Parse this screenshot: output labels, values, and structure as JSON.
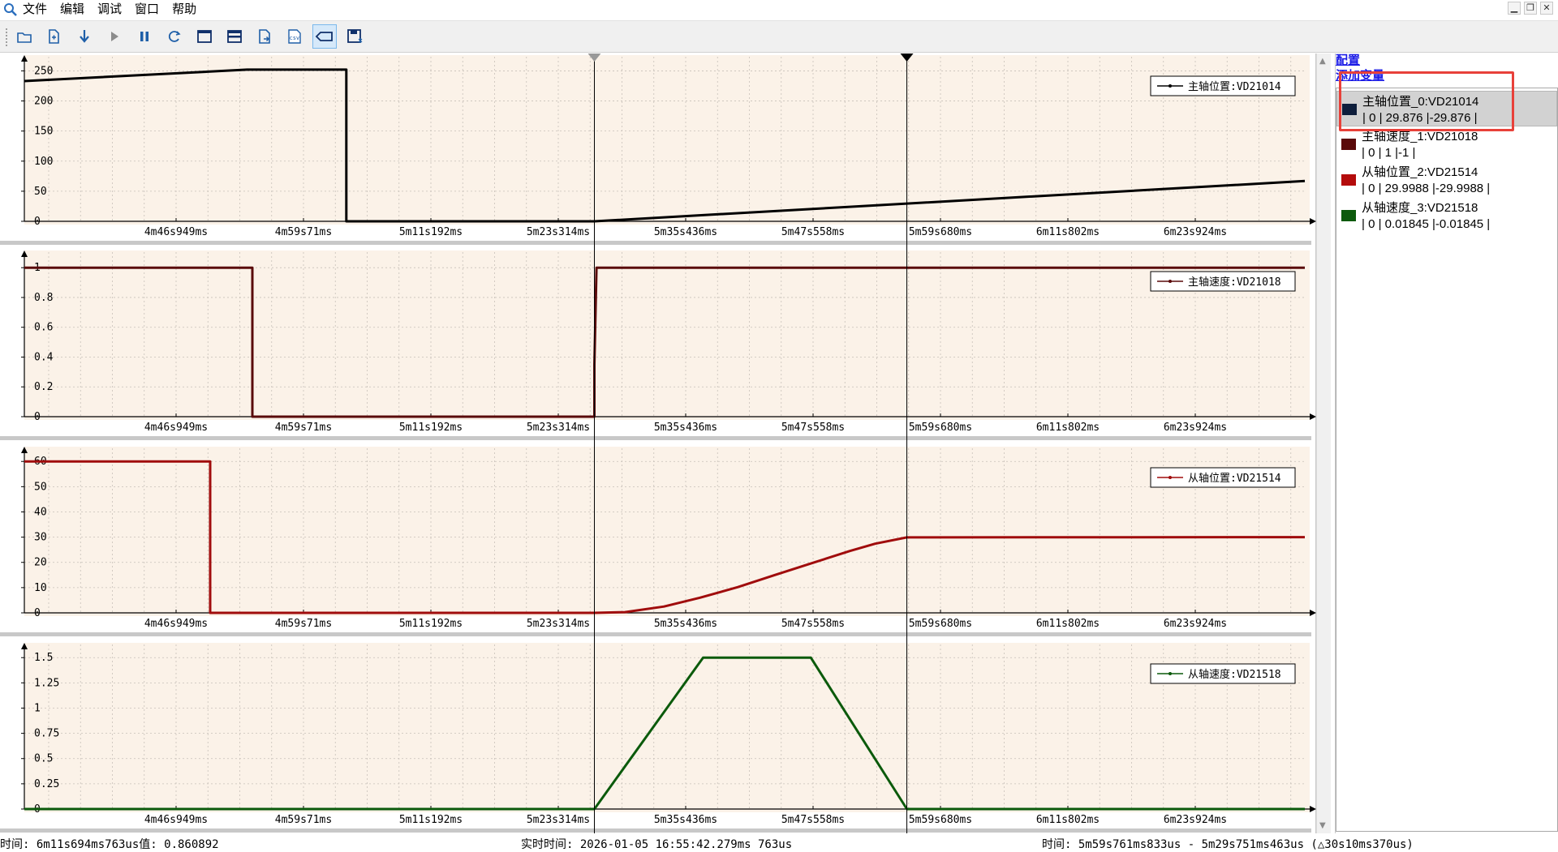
{
  "menu": {
    "items": [
      "文件",
      "编辑",
      "调试",
      "窗口",
      "帮助"
    ]
  },
  "window_controls": {
    "minimize": "▁",
    "restore": "❐",
    "close": "✕"
  },
  "toolbar": {
    "buttons": [
      {
        "name": "open-file",
        "icon": "folder-open-icon"
      },
      {
        "name": "new-file",
        "icon": "new-page-icon"
      },
      {
        "name": "download",
        "icon": "arrow-down-icon"
      },
      {
        "name": "play",
        "icon": "play-icon"
      },
      {
        "name": "pause",
        "icon": "pause-icon"
      },
      {
        "name": "refresh",
        "icon": "refresh-icon"
      },
      {
        "name": "single-view",
        "icon": "window-icon"
      },
      {
        "name": "split-view",
        "icon": "split-window-icon"
      },
      {
        "name": "export",
        "icon": "export-icon"
      },
      {
        "name": "csv",
        "icon": "csv-icon",
        "label": "csv"
      },
      {
        "name": "tag",
        "icon": "tag-icon",
        "active": true
      },
      {
        "name": "save-config",
        "icon": "save-icon"
      }
    ]
  },
  "side_panel": {
    "config_link": "配置",
    "add_variable_link": "添加变量",
    "variables": [
      {
        "name": "主轴位置_0:VD21014",
        "values": "| 0 | 29.876 |-29.876 |",
        "color": "#0e1e3c",
        "selected": true
      },
      {
        "name": "主轴速度_1:VD21018",
        "values": "| 0 | 1 |-1 |",
        "color": "#5a0a0a",
        "selected": false
      },
      {
        "name": "从轴位置_2:VD21514",
        "values": "| 0 | 29.9988 |-29.9988 |",
        "color": "#b40c0c",
        "selected": false
      },
      {
        "name": "从轴速度_3:VD21518",
        "values": "| 0 | 0.01845 |-0.01845 |",
        "color": "#0c5a0c",
        "selected": false
      }
    ]
  },
  "status_bar": {
    "time_value": "时间: 6m11s694ms763us值: 0.860892",
    "realtime": "实时时间: 2026-01-05 16:55:42.279ms 763us",
    "range": "时间: 5m59s761ms833us - 5m29s751ms463us (△30s10ms370us)"
  },
  "chart_data": [
    {
      "type": "line",
      "legend": "主轴位置:VD21014",
      "color": "#000000",
      "x_tick_labels": [
        "4m46s949ms",
        "4m59s71ms",
        "5m11s192ms",
        "5m23s314ms",
        "5m35s436ms",
        "5m47s558ms",
        "5m59s680ms",
        "6m11s802ms",
        "6m23s924ms"
      ],
      "x_range_s": [
        276.4,
        397.7
      ],
      "ylim": [
        0,
        260
      ],
      "y_ticks": [
        0,
        50,
        100,
        150,
        200,
        250
      ],
      "y_tick_labels": [
        "0",
        "50",
        "100",
        "150",
        "200",
        "250"
      ],
      "x_s": [
        276.4,
        297.5,
        306.9,
        306.9,
        330.4,
        397.7
      ],
      "y": [
        233,
        252,
        252,
        0,
        0,
        67
      ],
      "grid": true,
      "legend_position": "top-right"
    },
    {
      "type": "line",
      "legend": "主轴速度:VD21018",
      "color": "#5a0a0a",
      "x_tick_labels": [
        "4m46s949ms",
        "4m59s71ms",
        "5m11s192ms",
        "5m23s314ms",
        "5m35s436ms",
        "5m47s558ms",
        "5m59s680ms",
        "6m11s802ms",
        "6m23s924ms"
      ],
      "x_range_s": [
        276.4,
        397.7
      ],
      "ylim": [
        0,
        1.05
      ],
      "y_ticks": [
        0,
        0.2,
        0.4,
        0.6,
        0.8,
        1
      ],
      "y_tick_labels": [
        "0",
        "0.2",
        "0.4",
        "0.6",
        "0.8",
        "1"
      ],
      "x_s": [
        276.4,
        298.0,
        298.0,
        330.4,
        330.4,
        330.6,
        397.7
      ],
      "y": [
        1,
        1,
        0,
        0,
        0.35,
        1,
        1
      ],
      "grid": true,
      "legend_position": "top-right"
    },
    {
      "type": "line",
      "legend": "从轴位置:VD21514",
      "color": "#a00c0c",
      "x_tick_labels": [
        "4m46s949ms",
        "4m59s71ms",
        "5m11s192ms",
        "5m23s314ms",
        "5m35s436ms",
        "5m47s558ms",
        "5m59s680ms",
        "6m11s802ms",
        "6m23s924ms"
      ],
      "x_range_s": [
        276.4,
        397.7
      ],
      "ylim": [
        0,
        62
      ],
      "y_ticks": [
        0,
        10,
        20,
        30,
        40,
        50,
        60
      ],
      "y_tick_labels": [
        "0",
        "10",
        "20",
        "30",
        "40",
        "50",
        "60"
      ],
      "x_s": [
        276.4,
        294.0,
        294.0,
        330.4,
        333.3,
        337.0,
        340.4,
        344.0,
        347.5,
        351.0,
        354.6,
        357.0,
        360.0,
        397.7
      ],
      "y": [
        60,
        60,
        0,
        0,
        0.3,
        2.5,
        6,
        10.2,
        15,
        19.7,
        24.5,
        27.4,
        29.9,
        30
      ],
      "grid": true,
      "legend_position": "top-right"
    },
    {
      "type": "line",
      "legend": "从轴速度:VD21518",
      "color": "#0b5a0b",
      "x_tick_labels": [
        "4m46s949ms",
        "4m59s71ms",
        "5m11s192ms",
        "5m23s314ms",
        "5m35s436ms",
        "5m47s558ms",
        "5m59s680ms",
        "6m11s802ms",
        "6m23s924ms"
      ],
      "x_range_s": [
        276.4,
        397.7
      ],
      "ylim": [
        0,
        1.55
      ],
      "y_ticks": [
        0,
        0.25,
        0.5,
        0.75,
        1,
        1.25,
        1.5
      ],
      "y_tick_labels": [
        "0",
        "0.25",
        "0.5",
        "0.75",
        "1",
        "1.25",
        "1.5"
      ],
      "x_s": [
        276.4,
        330.4,
        340.7,
        350.9,
        360.0,
        397.7
      ],
      "y": [
        0,
        0,
        1.5,
        1.5,
        0,
        0
      ],
      "grid": true,
      "legend_position": "top-right"
    }
  ],
  "cursors_s": [
    330.4,
    360.0
  ]
}
